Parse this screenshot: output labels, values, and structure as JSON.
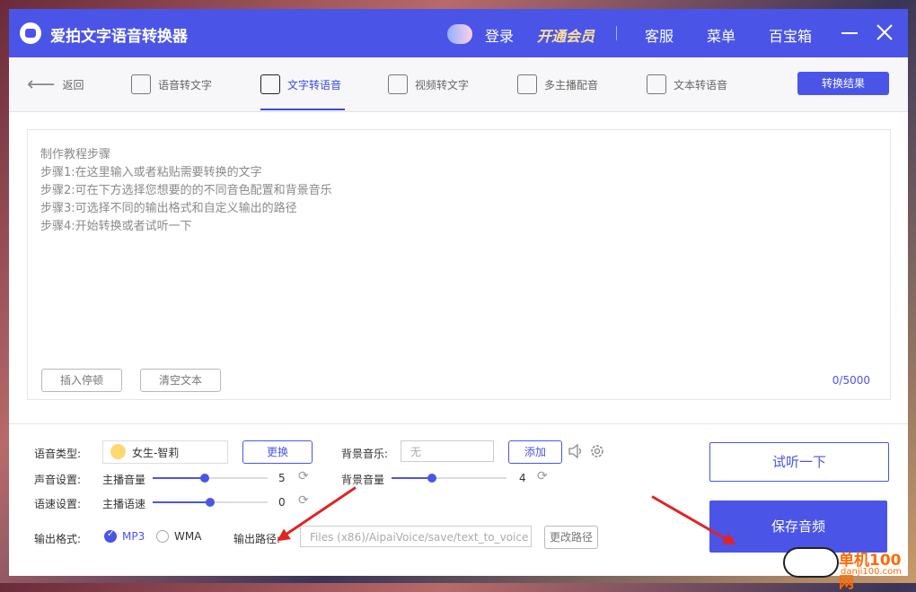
{
  "app": {
    "title": "爱拍文字语音转换器"
  },
  "titlebar": {
    "login": "登录",
    "vip": "开通会员",
    "service": "客服",
    "menu": "菜单",
    "toolbox": "百宝箱"
  },
  "tabs": {
    "back": "返回",
    "items": [
      "语音转文字",
      "文字转语音",
      "视频转文字",
      "多主播配音",
      "文本转语音"
    ],
    "active": "文字转语音",
    "result_button": "转换结果"
  },
  "editor": {
    "lines": [
      "制作教程步骤",
      "步骤1:在这里输入或者粘贴需要转换的文字",
      "步骤2:可在下方选择您想要的的不同音色配置和背景音乐",
      "步骤3:可选择不同的输出格式和自定义输出的路径",
      "步骤4:开始转换或者试听一下"
    ],
    "insert_pause": "插入停顿",
    "clear_text": "清空文本",
    "counter": "0/5000"
  },
  "settings": {
    "voice_type_label": "语音类型:",
    "voice_name": "女生-智莉",
    "change_button": "更换",
    "bg_music_label": "背景音乐:",
    "bg_music_value": "无",
    "add_button": "添加",
    "sound_label": "声音设置:",
    "anchor_volume_label": "主播音量",
    "anchor_volume_value": "5",
    "anchor_volume_level": 0.45,
    "bg_volume_label": "背景音量",
    "bg_volume_value": "4",
    "bg_volume_level": 0.35,
    "speed_label": "语速设置:",
    "anchor_speed_label": "主播语速",
    "anchor_speed_value": "0",
    "anchor_speed_level": 0.5,
    "format_label": "输出格式:",
    "formats": [
      "MP3",
      "WMA"
    ],
    "selected_format": "MP3",
    "output_path_label": "输出路径:",
    "output_path": "Files (x86)/AipaiVoice/save/text_to_voice",
    "change_path_button": "更改路径"
  },
  "actions": {
    "try_listen": "试听一下",
    "save_audio": "保存音频"
  },
  "watermark": {
    "text": "单机100网",
    "url": "danji100.com"
  },
  "colors": {
    "accent": "#4a55e8",
    "annotation_arrow": "#e02424"
  }
}
